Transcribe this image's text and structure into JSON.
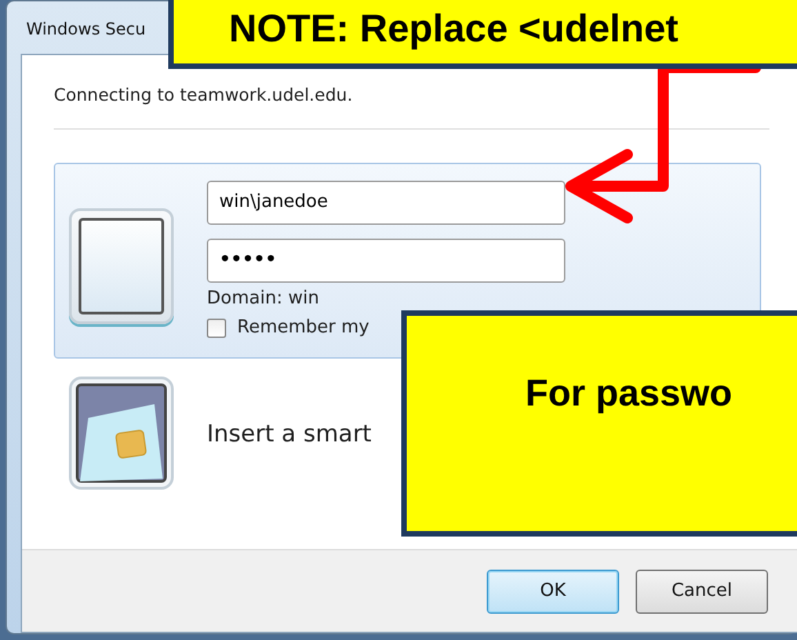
{
  "window": {
    "title": "Windows Secu"
  },
  "message": "Connecting to teamwork.udel.edu.",
  "credential_tiles": [
    {
      "kind": "password",
      "selected": true,
      "username": "win\\janedoe",
      "password": "•••••",
      "domain": "Domain: win",
      "remember": {
        "label": "Remember my",
        "checked": false
      }
    },
    {
      "kind": "smartcard",
      "selected": false,
      "label": "Insert a smart"
    }
  ],
  "buttons": [
    {
      "label": "OK",
      "default": true
    },
    {
      "label": "Cancel",
      "default": false
    }
  ],
  "callouts": [
    {
      "text": "NOTE: Replace <udelnet"
    },
    {
      "text": "For passwo"
    }
  ]
}
